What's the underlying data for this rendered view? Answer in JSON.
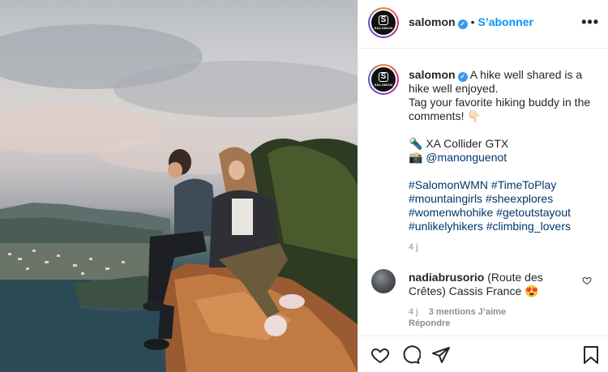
{
  "post": {
    "username": "salomon",
    "verified_mark": "✓",
    "separator": "•",
    "follow_label": "S’abonner",
    "more_label": "•••",
    "logo_letter": "S",
    "logo_wordmark": "SALOMON"
  },
  "caption": {
    "username": "salomon",
    "line1": "A hike well shared is a hike well enjoyed.",
    "line2": "Tag your favorite hiking buddy in the comments! 👇🏻",
    "gear_icon": "🔦",
    "gear_text": "XA Collider GTX",
    "camera_icon": "📸",
    "camera_text": "@manonguenot",
    "hashtags": [
      "#SalomonWMN #TimeToPlay",
      "#mountaingirls #sheexplores",
      "#womenwhohike #getoutstayout",
      "#unlikelyhikers #climbing_lovers"
    ],
    "time": "4 j"
  },
  "comment": {
    "username": "nadiabrusorio",
    "text": "(Route des Crêtes) Cassis France 😍",
    "time": "4 j",
    "likes": "3 mentions J’aime",
    "reply": "Répondre"
  },
  "actions": {
    "icons": [
      "heart-icon",
      "comment-icon",
      "share-icon",
      "bookmark-icon"
    ]
  }
}
